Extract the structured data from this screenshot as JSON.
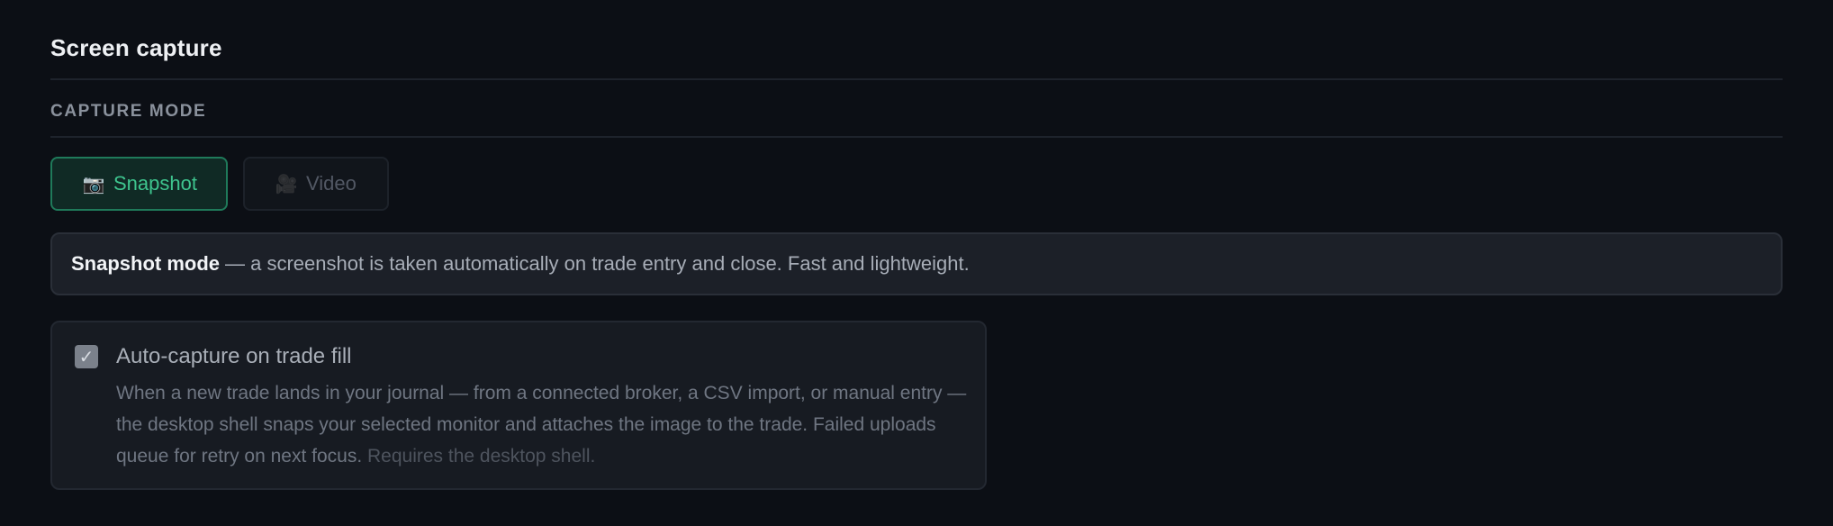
{
  "section": {
    "title": "Screen capture"
  },
  "capture_mode": {
    "heading": "CAPTURE MODE",
    "options": [
      {
        "icon": "camera-icon",
        "glyph": "📷",
        "label": "Snapshot",
        "selected": true
      },
      {
        "icon": "video-camera-icon",
        "glyph": "🎥",
        "label": "Video",
        "selected": false
      }
    ]
  },
  "info": {
    "title": "Snapshot mode",
    "text": "— a screenshot is taken automatically on trade entry and close. Fast and lightweight."
  },
  "auto_capture": {
    "checked": true,
    "check_glyph": "✓",
    "title": "Auto-capture on trade fill",
    "description": "When a new trade lands in your journal — from a connected broker, a CSV import, or manual entry — the desktop shell snaps your selected monitor and attaches the image to the trade. Failed uploads queue for retry on next focus.",
    "note": "Requires the desktop shell."
  },
  "colors": {
    "background": "#0c0f15",
    "accent": "#3ec48e",
    "accent_border": "#1f7a5a",
    "card": "#171b22"
  }
}
